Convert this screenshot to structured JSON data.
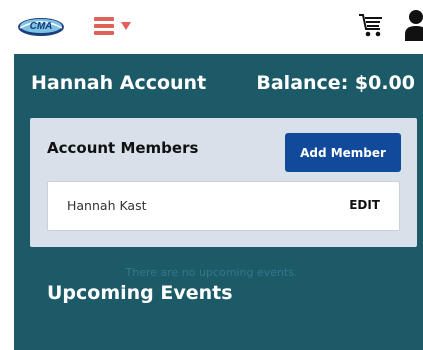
{
  "header": {
    "logo_alt": "CMA",
    "icons": {
      "menu": "hamburger-icon",
      "cart": "cart-icon",
      "user": "user-icon"
    }
  },
  "account": {
    "title": "Hannah Account",
    "balance": "Balance: $0.00"
  },
  "members": {
    "title": "Account Members",
    "add_label": "Add Member",
    "items": [
      {
        "name": "Hannah Kast",
        "edit_label": "EDIT"
      }
    ]
  },
  "events": {
    "title": "Upcoming Events",
    "empty_message": "There are no upcoming events."
  },
  "colors": {
    "teal_background": "#1c5a68",
    "card_background": "#d8e1ea",
    "button_blue": "#124a9b",
    "menu_accent": "#e0605a"
  }
}
